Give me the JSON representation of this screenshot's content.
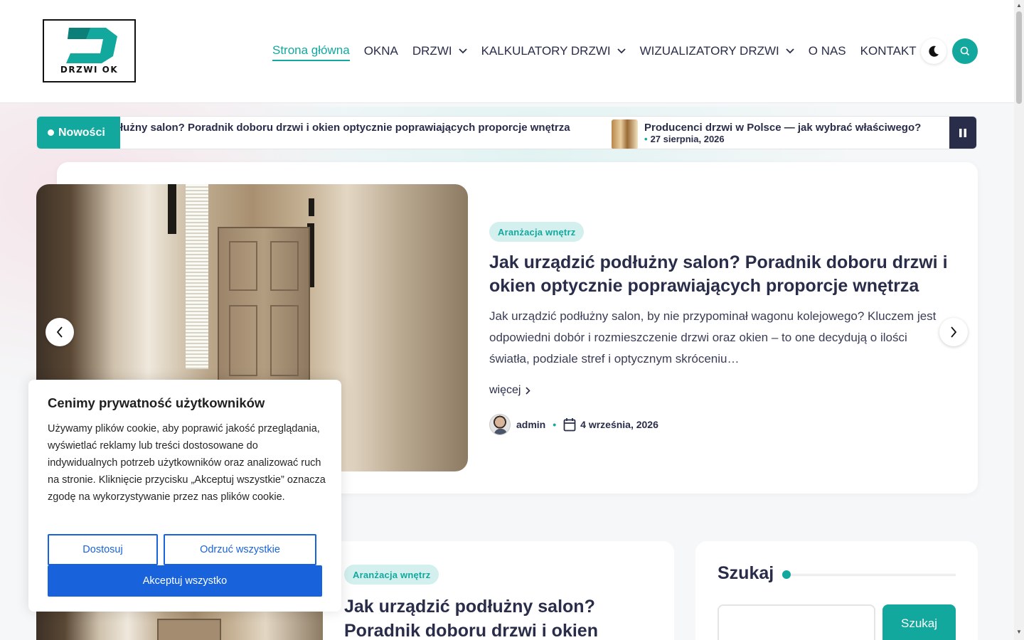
{
  "brand": {
    "logo_text": "DRZWI OK",
    "accent": "#13a89e",
    "dark": "#2a2d4a"
  },
  "nav": {
    "items": [
      {
        "label": "Strona główna",
        "active": true,
        "has_dropdown": false
      },
      {
        "label": "OKNA",
        "active": false,
        "has_dropdown": false
      },
      {
        "label": "DRZWI",
        "active": false,
        "has_dropdown": true
      },
      {
        "label": "KALKULATORY DRZWI",
        "active": false,
        "has_dropdown": true
      },
      {
        "label": "WIZUALIZATORY DRZWI",
        "active": false,
        "has_dropdown": true
      },
      {
        "label": "O NAS",
        "active": false,
        "has_dropdown": false
      },
      {
        "label": "KONTAKT",
        "active": false,
        "has_dropdown": false
      }
    ],
    "dark_mode_icon": "moon-icon",
    "search_icon": "search-icon"
  },
  "ticker": {
    "label": "Nowości",
    "item1_text": "łużny salon? Poradnik doboru drzwi i okien optycznie poprawiających proporcje wnętrza",
    "item2_title": "Producenci drzwi w Polsce — jak wybrać właściwego?",
    "item2_date": "27 sierpnia, 2026",
    "pause_icon": "pause-icon"
  },
  "hero": {
    "category": "Aranżacja wnętrz",
    "title": "Jak urządzić podłużny salon? Poradnik doboru drzwi i okien optycznie poprawiających proporcje wnętrza",
    "excerpt": "Jak urządzić podłużny salon, by nie przypominał wagonu kolejowego? Kluczem jest odpowiedni dobór i rozmieszczenie drzwi oraz okien – to one decydują o ilości światła, podziale stref i optycznym skróceniu…",
    "more_label": "więcej",
    "author": "admin",
    "date": "4 września, 2026"
  },
  "post": {
    "category": "Aranżacja wnętrz",
    "title": "Jak urządzić podłużny salon? Poradnik doboru drzwi i okien"
  },
  "sidebar": {
    "search_title": "Szukaj",
    "search_button": "Szukaj",
    "search_placeholder": ""
  },
  "cookie": {
    "title": "Cenimy prywatność użytkowników",
    "text": "Używamy plików cookie, aby poprawić jakość przeglądania, wyświetlać reklamy lub treści dostosowane do indywidualnych potrzeb użytkowników oraz analizować ruch na stronie. Kliknięcie przycisku „Akceptuj wszystkie” oznacza zgodę na wykorzystywanie przez nas plików cookie.",
    "customize": "Dostosuj",
    "reject": "Odrzuć wszystkie",
    "accept": "Akceptuj wszystko",
    "button_color": "#1863dc"
  }
}
